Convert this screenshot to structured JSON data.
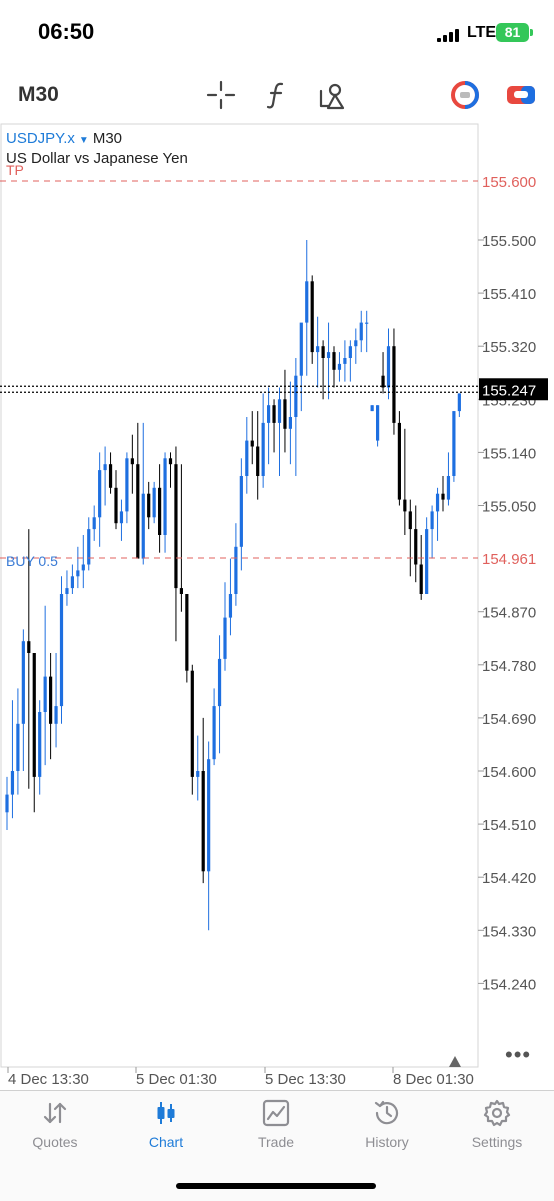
{
  "status": {
    "time": "06:50",
    "network": "LTE",
    "battery": "81"
  },
  "toolbar": {
    "timeframe": "M30",
    "icons": [
      "crosshair-icon",
      "function-icon",
      "objects-icon",
      "one-click-trading-icon",
      "new-order-icon"
    ]
  },
  "chart": {
    "symbol": "USDJPY.x",
    "timeframe": "M30",
    "description": "US Dollar vs Japanese Yen",
    "tp_label": "TP",
    "buy_label": "BUY 0.5",
    "more": "•••",
    "colors": {
      "bull": "#1e6fe0",
      "bear": "#000000",
      "level_line": "#e0605c",
      "symbol": "#1e7bd8"
    }
  },
  "chart_data": {
    "type": "candlestick",
    "symbol": "USDJPY.x",
    "timeframe": "M30",
    "y_ticks": [
      "155.500",
      "155.410",
      "155.320",
      "155.230",
      "155.140",
      "155.050",
      "154.870",
      "154.780",
      "154.690",
      "154.600",
      "154.510",
      "154.420",
      "154.330",
      "154.240"
    ],
    "ylim": [
      154.19,
      155.625
    ],
    "x_ticks": [
      "4 Dec 13:30",
      "5 Dec 01:30",
      "5 Dec 13:30",
      "8 Dec 01:30"
    ],
    "levels": [
      {
        "label": "TP",
        "price": 155.6,
        "price_label": "155.600"
      },
      {
        "label": "BUY 0.5",
        "price": 154.961,
        "price_label": "154.961"
      }
    ],
    "current_price": 155.247,
    "current_price_label": "155.247",
    "ohlc": [
      [
        154.53,
        154.59,
        154.5,
        154.56
      ],
      [
        154.56,
        154.72,
        154.52,
        154.6
      ],
      [
        154.6,
        154.74,
        154.56,
        154.68
      ],
      [
        154.68,
        154.84,
        154.6,
        154.82
      ],
      [
        154.82,
        155.01,
        154.57,
        154.8
      ],
      [
        154.8,
        154.78,
        154.53,
        154.59
      ],
      [
        154.59,
        154.72,
        154.56,
        154.7
      ],
      [
        154.7,
        154.88,
        154.61,
        154.76
      ],
      [
        154.76,
        154.8,
        154.62,
        154.68
      ],
      [
        154.68,
        154.8,
        154.64,
        154.71
      ],
      [
        154.71,
        154.93,
        154.68,
        154.9
      ],
      [
        154.9,
        154.94,
        154.88,
        154.91
      ],
      [
        154.91,
        154.95,
        154.9,
        154.93
      ],
      [
        154.93,
        154.98,
        154.91,
        154.94
      ],
      [
        154.94,
        155.0,
        154.91,
        154.95
      ],
      [
        154.95,
        155.03,
        154.94,
        155.01
      ],
      [
        155.01,
        155.05,
        154.99,
        155.03
      ],
      [
        155.03,
        155.14,
        154.98,
        155.11
      ],
      [
        155.11,
        155.15,
        155.05,
        155.12
      ],
      [
        155.12,
        155.14,
        155.07,
        155.08
      ],
      [
        155.08,
        155.11,
        155.01,
        155.02
      ],
      [
        155.02,
        155.06,
        154.99,
        155.04
      ],
      [
        155.04,
        155.14,
        155.02,
        155.13
      ],
      [
        155.13,
        155.17,
        155.07,
        155.12
      ],
      [
        155.12,
        155.19,
        154.97,
        154.96
      ],
      [
        154.96,
        155.19,
        154.95,
        155.07
      ],
      [
        155.07,
        155.09,
        155.01,
        155.03
      ],
      [
        155.03,
        155.09,
        155.02,
        155.08
      ],
      [
        155.08,
        155.12,
        154.97,
        155.0
      ],
      [
        155.0,
        155.14,
        154.97,
        155.13
      ],
      [
        155.13,
        155.14,
        155.08,
        155.12
      ],
      [
        155.12,
        155.15,
        154.82,
        154.91
      ],
      [
        154.91,
        155.12,
        154.87,
        154.9
      ],
      [
        154.9,
        154.83,
        154.75,
        154.77
      ],
      [
        154.77,
        154.78,
        154.56,
        154.59
      ],
      [
        154.59,
        154.66,
        154.55,
        154.6
      ],
      [
        154.6,
        154.69,
        154.41,
        154.43
      ],
      [
        154.43,
        154.65,
        154.33,
        154.62
      ],
      [
        154.62,
        154.74,
        154.61,
        154.71
      ],
      [
        154.71,
        154.83,
        154.63,
        154.79
      ],
      [
        154.79,
        154.92,
        154.77,
        154.86
      ],
      [
        154.86,
        154.96,
        154.83,
        154.9
      ],
      [
        154.9,
        155.02,
        154.88,
        154.98
      ],
      [
        154.98,
        155.13,
        154.94,
        155.1
      ],
      [
        155.1,
        155.2,
        155.07,
        155.16
      ],
      [
        155.16,
        155.21,
        155.12,
        155.15
      ],
      [
        155.15,
        155.21,
        155.06,
        155.1
      ],
      [
        155.1,
        155.24,
        155.08,
        155.19
      ],
      [
        155.19,
        155.25,
        155.12,
        155.22
      ],
      [
        155.22,
        155.23,
        155.14,
        155.19
      ],
      [
        155.19,
        155.25,
        155.1,
        155.23
      ],
      [
        155.23,
        155.28,
        155.14,
        155.18
      ],
      [
        155.18,
        155.26,
        155.12,
        155.2
      ],
      [
        155.2,
        155.3,
        155.1,
        155.27
      ],
      [
        155.27,
        155.33,
        155.21,
        155.36
      ],
      [
        155.36,
        155.5,
        155.27,
        155.43
      ],
      [
        155.43,
        155.44,
        155.29,
        155.31
      ],
      [
        155.31,
        155.37,
        155.25,
        155.32
      ],
      [
        155.32,
        155.33,
        155.23,
        155.3
      ],
      [
        155.3,
        155.36,
        155.23,
        155.31
      ],
      [
        155.31,
        155.32,
        155.25,
        155.28
      ],
      [
        155.28,
        155.31,
        155.26,
        155.29
      ],
      [
        155.29,
        155.33,
        155.26,
        155.3
      ],
      [
        155.3,
        155.33,
        155.26,
        155.32
      ],
      [
        155.32,
        155.35,
        155.29,
        155.33
      ],
      [
        155.33,
        155.38,
        155.31,
        155.36
      ],
      [
        155.36,
        155.38,
        155.31,
        155.36
      ],
      [
        155.21,
        155.22,
        155.21,
        155.22
      ],
      [
        155.16,
        155.22,
        155.15,
        155.22
      ],
      [
        155.27,
        155.31,
        155.24,
        155.25
      ],
      [
        155.25,
        155.35,
        155.23,
        155.32
      ],
      [
        155.32,
        155.35,
        155.17,
        155.19
      ],
      [
        155.19,
        155.21,
        155.05,
        155.06
      ],
      [
        155.06,
        155.18,
        155.0,
        155.04
      ],
      [
        155.04,
        155.06,
        154.93,
        155.01
      ],
      [
        155.01,
        155.05,
        154.92,
        154.95
      ],
      [
        154.95,
        155.0,
        154.89,
        154.9
      ],
      [
        154.9,
        155.03,
        154.95,
        155.01
      ],
      [
        155.01,
        155.05,
        154.96,
        155.04
      ],
      [
        155.04,
        155.08,
        154.99,
        155.07
      ],
      [
        155.07,
        155.1,
        155.04,
        155.06
      ],
      [
        155.06,
        155.14,
        155.05,
        155.1
      ],
      [
        155.1,
        155.21,
        155.09,
        155.21
      ],
      [
        155.21,
        155.24,
        155.2,
        155.24
      ]
    ]
  },
  "tabs": [
    {
      "label": "Quotes",
      "icon": "quotes-icon",
      "active": false
    },
    {
      "label": "Chart",
      "icon": "chart-icon",
      "active": true
    },
    {
      "label": "Trade",
      "icon": "trade-icon",
      "active": false
    },
    {
      "label": "History",
      "icon": "history-icon",
      "active": false
    },
    {
      "label": "Settings",
      "icon": "settings-icon",
      "active": false
    }
  ]
}
